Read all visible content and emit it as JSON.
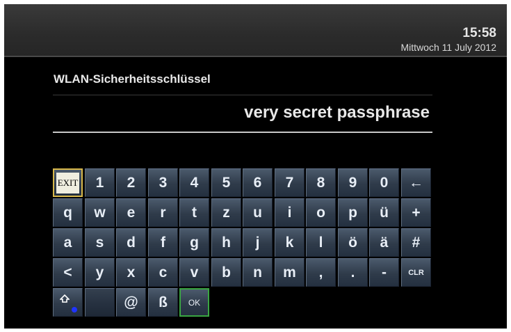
{
  "header": {
    "time": "15:58",
    "date": "Mittwoch 11 July 2012"
  },
  "form": {
    "label": "WLAN-Sicherheitsschlüssel",
    "value": "very secret passphrase"
  },
  "keyboard": {
    "rows": [
      [
        {
          "label": "EXIT",
          "name": "key-exit",
          "selected": true
        },
        {
          "label": "1",
          "name": "key-1"
        },
        {
          "label": "2",
          "name": "key-2"
        },
        {
          "label": "3",
          "name": "key-3"
        },
        {
          "label": "4",
          "name": "key-4"
        },
        {
          "label": "5",
          "name": "key-5"
        },
        {
          "label": "6",
          "name": "key-6"
        },
        {
          "label": "7",
          "name": "key-7"
        },
        {
          "label": "8",
          "name": "key-8"
        },
        {
          "label": "9",
          "name": "key-9"
        },
        {
          "label": "0",
          "name": "key-0"
        },
        {
          "label": "←",
          "name": "key-backspace"
        }
      ],
      [
        {
          "label": "q",
          "name": "key-q"
        },
        {
          "label": "w",
          "name": "key-w"
        },
        {
          "label": "e",
          "name": "key-e"
        },
        {
          "label": "r",
          "name": "key-r"
        },
        {
          "label": "t",
          "name": "key-t"
        },
        {
          "label": "z",
          "name": "key-z"
        },
        {
          "label": "u",
          "name": "key-u"
        },
        {
          "label": "i",
          "name": "key-i"
        },
        {
          "label": "o",
          "name": "key-o"
        },
        {
          "label": "p",
          "name": "key-p"
        },
        {
          "label": "ü",
          "name": "key-u-umlaut"
        },
        {
          "label": "+",
          "name": "key-plus"
        }
      ],
      [
        {
          "label": "a",
          "name": "key-a"
        },
        {
          "label": "s",
          "name": "key-s"
        },
        {
          "label": "d",
          "name": "key-d"
        },
        {
          "label": "f",
          "name": "key-f"
        },
        {
          "label": "g",
          "name": "key-g"
        },
        {
          "label": "h",
          "name": "key-h"
        },
        {
          "label": "j",
          "name": "key-j"
        },
        {
          "label": "k",
          "name": "key-k"
        },
        {
          "label": "l",
          "name": "key-l"
        },
        {
          "label": "ö",
          "name": "key-o-umlaut"
        },
        {
          "label": "ä",
          "name": "key-a-umlaut"
        },
        {
          "label": "#",
          "name": "key-hash"
        }
      ],
      [
        {
          "label": "<",
          "name": "key-less-than"
        },
        {
          "label": "y",
          "name": "key-y"
        },
        {
          "label": "x",
          "name": "key-x"
        },
        {
          "label": "c",
          "name": "key-c"
        },
        {
          "label": "v",
          "name": "key-v"
        },
        {
          "label": "b",
          "name": "key-b"
        },
        {
          "label": "n",
          "name": "key-n"
        },
        {
          "label": "m",
          "name": "key-m"
        },
        {
          "label": ",",
          "name": "key-comma"
        },
        {
          "label": ".",
          "name": "key-period"
        },
        {
          "label": "-",
          "name": "key-minus"
        },
        {
          "label": "CLR",
          "name": "key-clear"
        }
      ],
      [
        {
          "label": "",
          "name": "key-shift",
          "icon": "shift-icon"
        },
        {
          "label": "",
          "name": "key-space"
        },
        {
          "label": "@",
          "name": "key-at"
        },
        {
          "label": "ß",
          "name": "key-eszett"
        },
        {
          "label": "OK",
          "name": "key-ok",
          "ok": true
        }
      ]
    ]
  },
  "colors": {
    "background": "#000000",
    "key": "#2f3b4a",
    "exit_highlight": "#d8b84a",
    "ok_highlight": "#3aa642",
    "shift_indicator": "#1f34ff"
  }
}
